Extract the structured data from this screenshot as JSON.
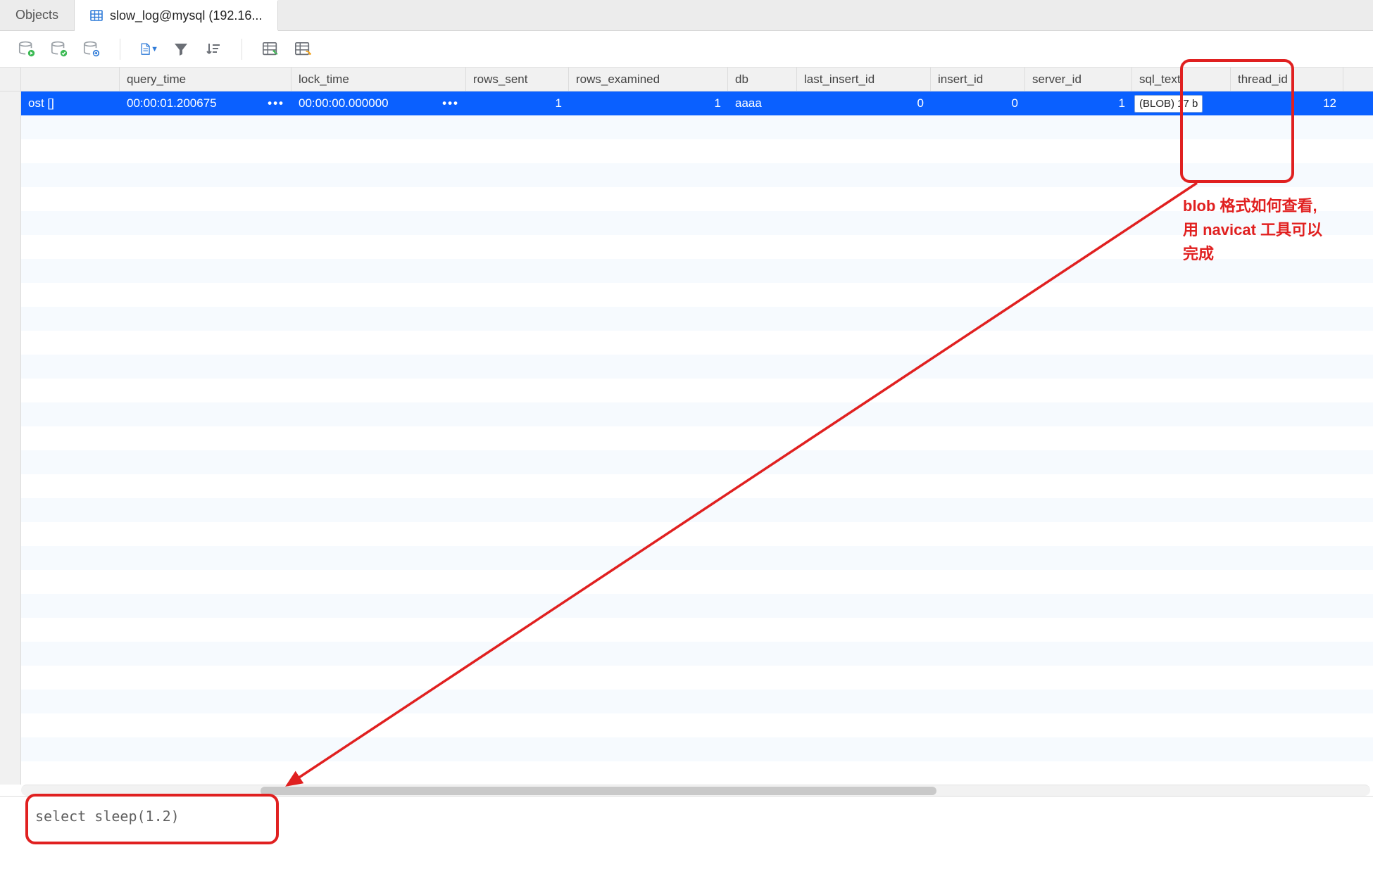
{
  "tabs": {
    "objects": "Objects",
    "active": "slow_log@mysql (192.16..."
  },
  "toolbar": {
    "db_play": "db-play",
    "db_ok": "db-ok",
    "db_refresh": "db-refresh",
    "doc": "document",
    "filter": "filter",
    "sort": "sort",
    "import": "import",
    "export": "export"
  },
  "grid": {
    "columns": [
      {
        "key": "user_host",
        "label": "",
        "w": "cw-user",
        "align": "left"
      },
      {
        "key": "query_time",
        "label": "query_time",
        "w": "cw-qt",
        "align": "left"
      },
      {
        "key": "lock_time",
        "label": "lock_time",
        "w": "cw-lt",
        "align": "left"
      },
      {
        "key": "rows_sent",
        "label": "rows_sent",
        "w": "cw-rs",
        "align": "right"
      },
      {
        "key": "rows_examined",
        "label": "rows_examined",
        "w": "cw-re",
        "align": "right"
      },
      {
        "key": "db",
        "label": "db",
        "w": "cw-db",
        "align": "left"
      },
      {
        "key": "last_insert_id",
        "label": "last_insert_id",
        "w": "cw-li",
        "align": "right"
      },
      {
        "key": "insert_id",
        "label": "insert_id",
        "w": "cw-ii",
        "align": "right"
      },
      {
        "key": "server_id",
        "label": "server_id",
        "w": "cw-si",
        "align": "right"
      },
      {
        "key": "sql_text",
        "label": "sql_text",
        "w": "cw-st",
        "align": "left"
      },
      {
        "key": "thread_id",
        "label": "thread_id",
        "w": "cw-ti",
        "align": "right"
      }
    ],
    "row": {
      "user_host": "ost []",
      "query_time": "00:00:01.200675",
      "query_time_suffix": "•••",
      "lock_time": "00:00:00.000000",
      "lock_time_suffix": "•••",
      "rows_sent": "1",
      "rows_examined": "1",
      "db": "aaaa",
      "last_insert_id": "0",
      "insert_id": "0",
      "server_id": "1",
      "sql_text": "(BLOB) 17 b",
      "thread_id": "12"
    },
    "row_marker": "I"
  },
  "blob_panel": {
    "content": "select sleep(1.2)"
  },
  "annotation": {
    "line1": "blob 格式如何查看,",
    "line2": "用 navicat 工具可以",
    "line3": "完成"
  }
}
